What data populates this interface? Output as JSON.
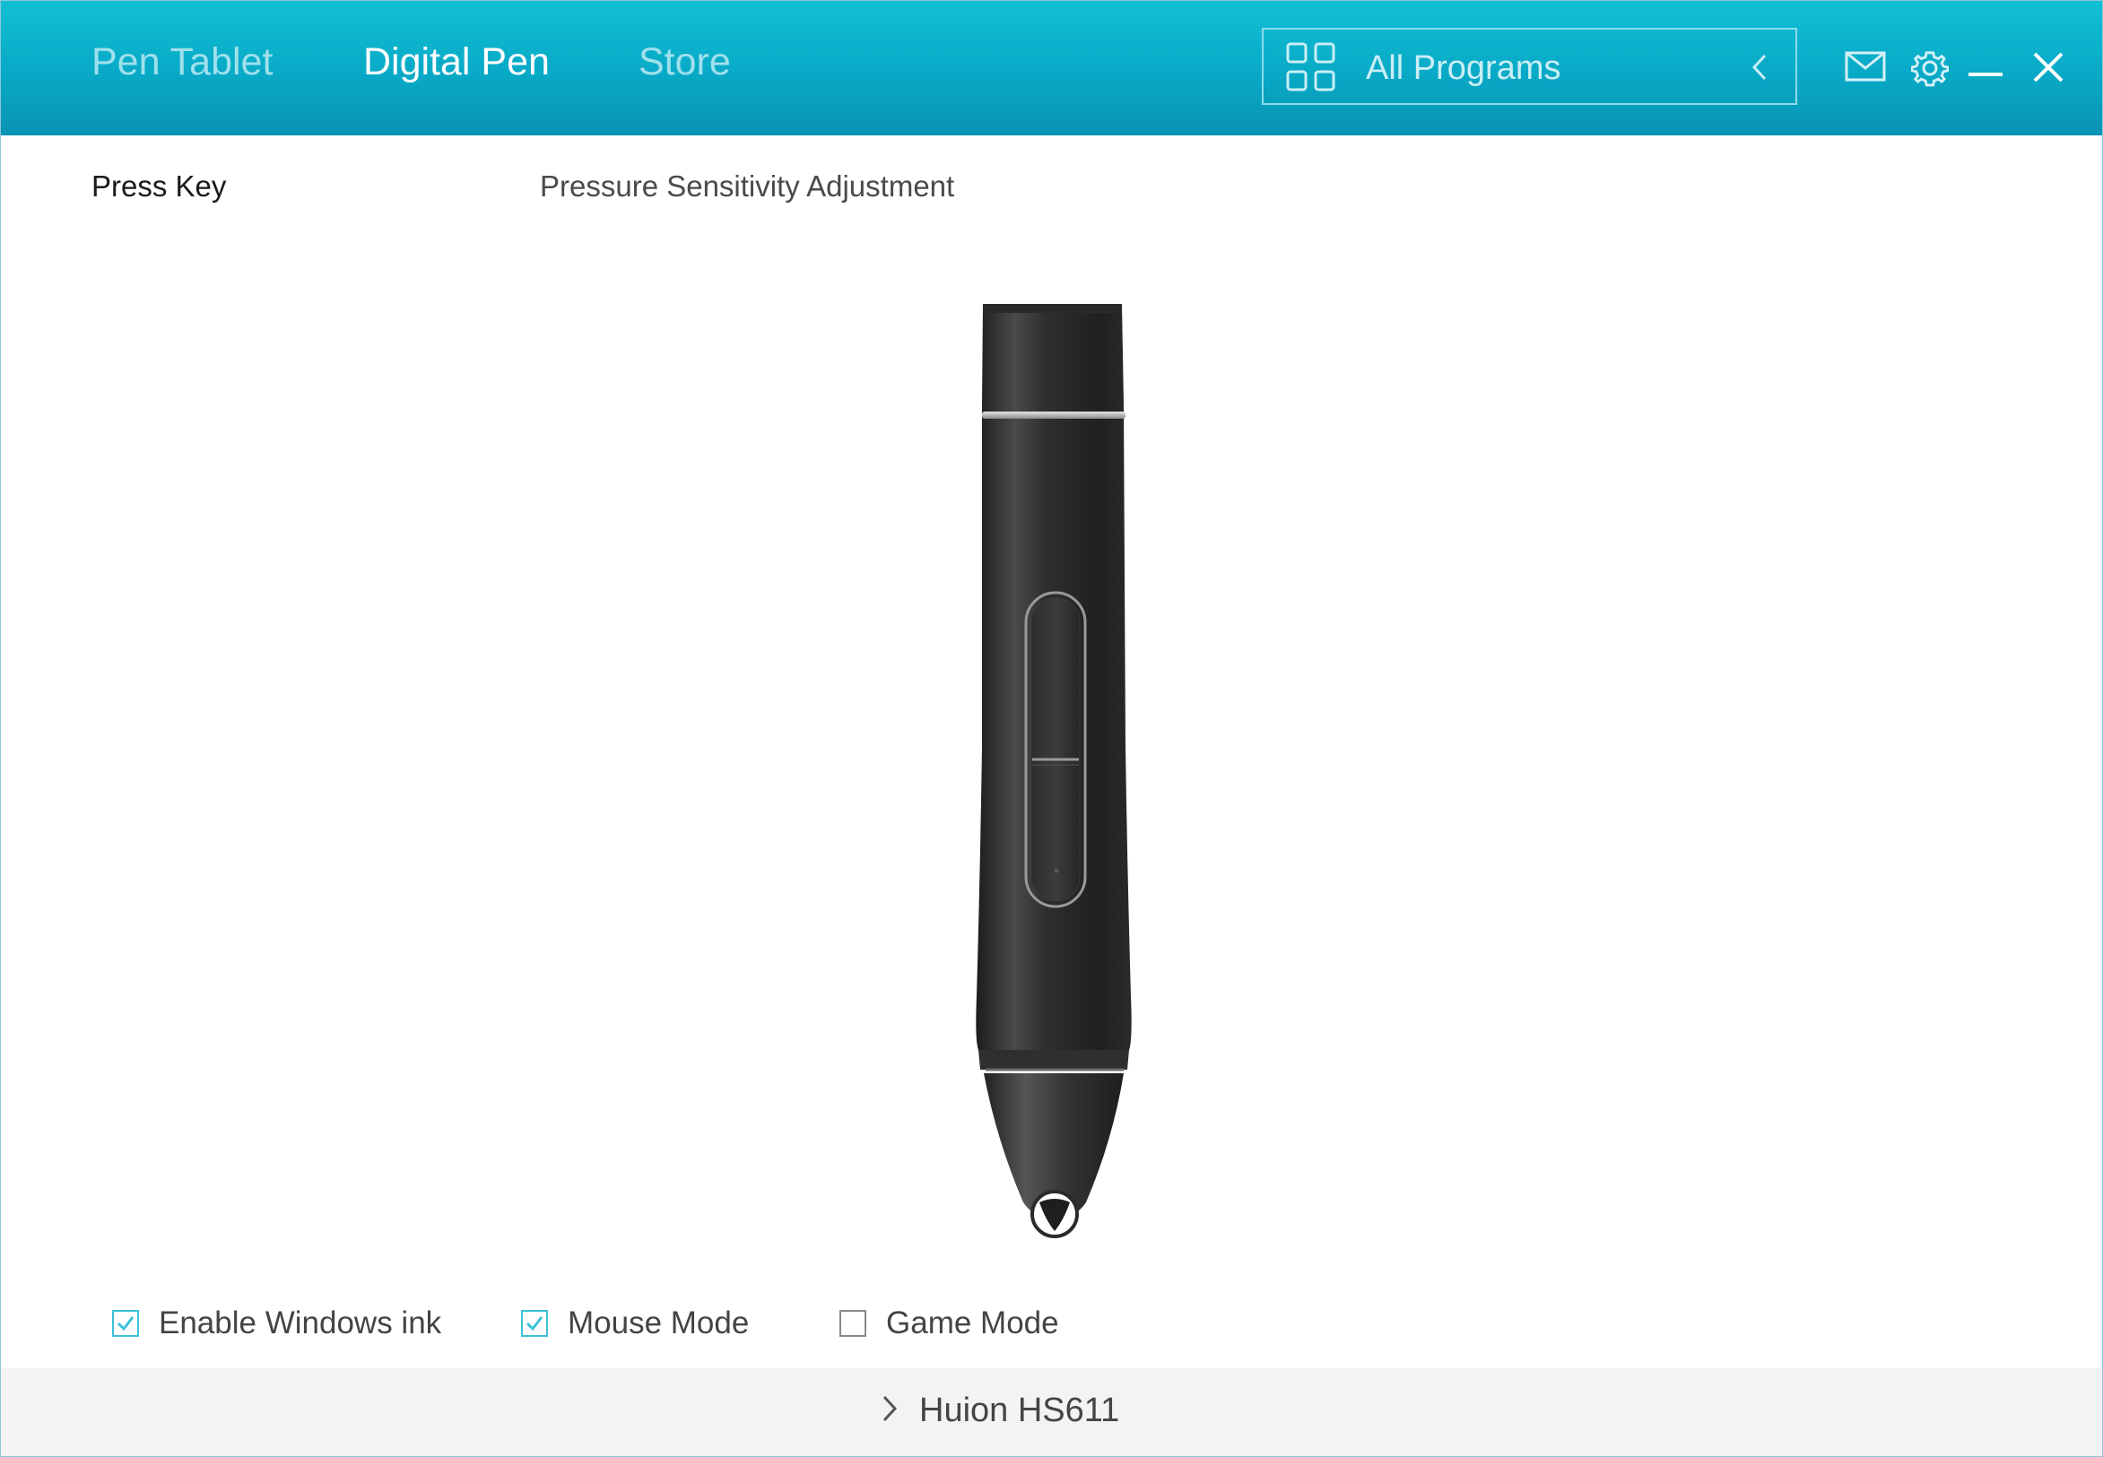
{
  "header": {
    "tabs": [
      {
        "label": "Pen Tablet",
        "active": false
      },
      {
        "label": "Digital Pen",
        "active": true
      },
      {
        "label": "Store",
        "active": false
      }
    ],
    "program_selector": {
      "icon": "grid-icon",
      "label": "All Programs",
      "arrow_icon": "chevron-left-icon"
    },
    "icons": [
      "mail-icon",
      "gear-icon",
      "minimize-icon",
      "close-icon"
    ]
  },
  "subtabs": [
    {
      "label": "Press Key",
      "active": true
    },
    {
      "label": "Pressure Sensitivity Adjustment",
      "active": false
    }
  ],
  "pen_image": {
    "icon": "digital-pen-illustration"
  },
  "options": [
    {
      "label": "Enable Windows ink",
      "checked": true
    },
    {
      "label": "Mouse Mode",
      "checked": true
    },
    {
      "label": "Game Mode",
      "checked": false
    }
  ],
  "footer": {
    "device_name": "Huion HS611",
    "icon": "chevron-right-icon"
  },
  "colors": {
    "header_gradient_top": "#12bfd6",
    "header_gradient_bottom": "#0a93b4",
    "accent": "#3cc1d8",
    "footer_bg": "#f3f3f4"
  }
}
